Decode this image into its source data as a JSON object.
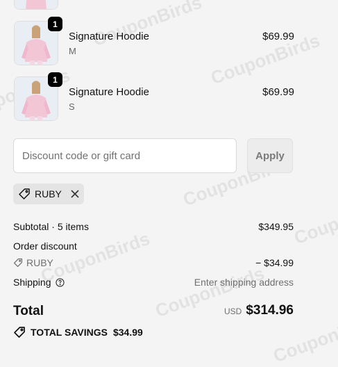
{
  "cart": {
    "items": [
      {
        "name": "Signature Hoodie",
        "variant": "M",
        "price": "$69.99",
        "quantity": "1"
      },
      {
        "name": "Signature Hoodie",
        "variant": "S",
        "price": "$69.99",
        "quantity": "1"
      }
    ]
  },
  "discount": {
    "placeholder": "Discount code or gift card",
    "value": "",
    "apply_label": "Apply",
    "applied_code": "RUBY"
  },
  "summary": {
    "subtotal_label": "Subtotal · 5 items",
    "subtotal_value": "$349.95",
    "order_discount_label": "Order discount",
    "discount_code": "RUBY",
    "discount_value": "− $34.99",
    "shipping_label": "Shipping",
    "shipping_value": "Enter shipping address",
    "total_label": "Total",
    "currency": "USD",
    "total_value": "$314.96",
    "savings_label": "TOTAL SAVINGS",
    "savings_value": "$34.99"
  },
  "watermark": "CouponBirds",
  "icons": {
    "tag": "tag-icon",
    "close": "close-icon",
    "help": "help-circle-icon",
    "savings": "tag-icon"
  }
}
